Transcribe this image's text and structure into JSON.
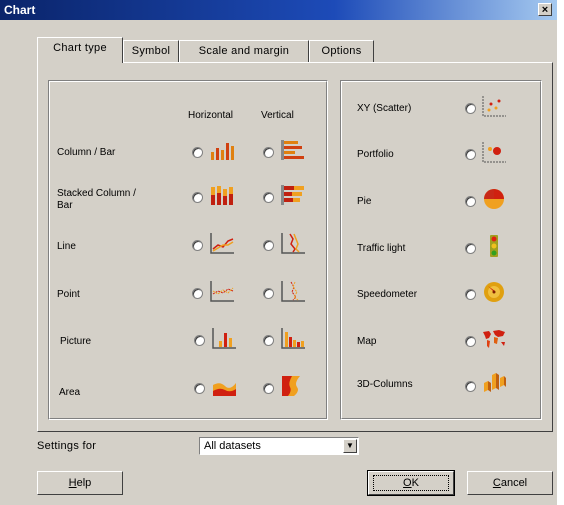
{
  "window": {
    "title": "Chart",
    "close_glyph": "×"
  },
  "tabs": [
    {
      "label": "Chart type",
      "active": true
    },
    {
      "label": "Symbol"
    },
    {
      "label": "Scale and margin"
    },
    {
      "label": "Options"
    }
  ],
  "left_group": {
    "col_horizontal": "Horizontal",
    "col_vertical": "Vertical",
    "rows": [
      {
        "label_lines": [
          "Column / Bar"
        ]
      },
      {
        "label_lines": [
          "Stacked Column /",
          "Bar"
        ]
      },
      {
        "label_lines": [
          "Line"
        ]
      },
      {
        "label_lines": [
          "Point"
        ]
      },
      {
        "label_lines": [
          "Picture"
        ]
      },
      {
        "label_lines": [
          "Area"
        ]
      }
    ]
  },
  "right_group": {
    "rows": [
      {
        "label": "XY (Scatter)",
        "icon": "scatter-chart-icon"
      },
      {
        "label": "Portfolio",
        "icon": "portfolio-chart-icon"
      },
      {
        "label": "Pie",
        "icon": "pie-chart-icon"
      },
      {
        "label": "Traffic light",
        "icon": "traffic-light-icon"
      },
      {
        "label": "Speedometer",
        "icon": "speedometer-icon"
      },
      {
        "label": "Map",
        "icon": "world-map-icon"
      },
      {
        "label": "3D-Columns",
        "icon": "3d-columns-icon"
      }
    ]
  },
  "settings": {
    "label": "Settings for",
    "value": "All datasets",
    "arrow": "▼"
  },
  "buttons": {
    "help": {
      "accel": "H",
      "rest": "elp"
    },
    "ok": {
      "accel": "O",
      "rest": "K"
    },
    "cancel": {
      "accel": "C",
      "rest": "ancel"
    }
  },
  "colors": {
    "face": "#d4d0c8",
    "title_blue": "#0a246a",
    "orange": "#f0a020",
    "red": "#d02010"
  }
}
